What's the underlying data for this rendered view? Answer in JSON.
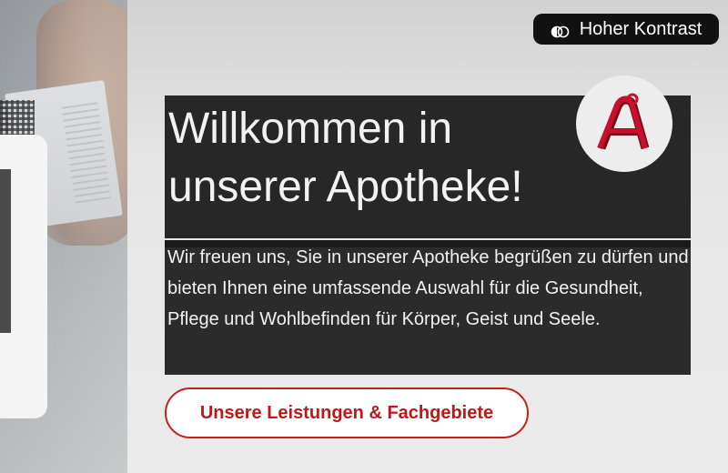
{
  "contrast_toggle": {
    "label": "Hoher Kontrast",
    "icon": "contrast-icon"
  },
  "logo": {
    "icon": "apotheke-a-logo",
    "color": "#c8102e"
  },
  "hero": {
    "title": "Willkommen in unserer Apotheke!",
    "text": "Wir freuen uns, Sie in unserer Apotheke begrüßen zu dürfen und bieten Ihnen eine umfassende Auswahl für die Gesundheit, Pflege und Wohlbefinden für Körper, Geist und Seele."
  },
  "cta": {
    "label": "Unsere Leistungen & Fachgebiete",
    "color": "#c81e1e"
  }
}
